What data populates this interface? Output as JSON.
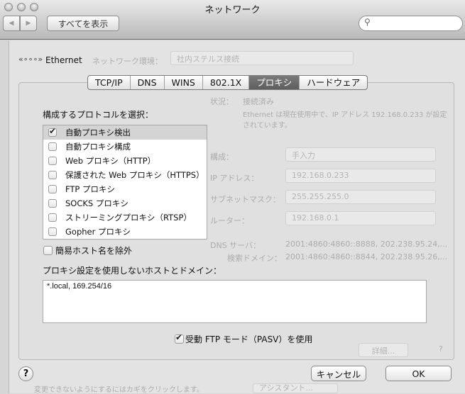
{
  "window": {
    "title": "ネットワーク"
  },
  "toolbar": {
    "back": "◀",
    "forward": "▶",
    "show_all": "すべてを表示",
    "search_placeholder": ""
  },
  "background": {
    "service": "Ethernet",
    "location_label": "ネットワーク環境：",
    "location_value": "社内ステルス接続",
    "status_label": "状況：",
    "status_value": "接続済み",
    "status_desc": "Ethernet は現在使用中で、IP アドレス 192.168.0.233 が設定されています。",
    "fields": [
      {
        "label": "構成：",
        "value": "手入力"
      },
      {
        "label": "IP アドレス：",
        "value": "192.168.0.233"
      },
      {
        "label": "サブネットマスク：",
        "value": "255.255.255.0"
      },
      {
        "label": "ルーター：",
        "value": "192.168.0.1"
      },
      {
        "label": "DNS サーバ：",
        "value": "2001:4860:4860::8888, 202.238.95.24,..."
      },
      {
        "label": "検索ドメイン：",
        "value": "2001:4860:4860::8844, 202.238.95.26,..."
      }
    ],
    "advanced": "詳細...",
    "lock_text": "変更できないようにするにはカギをクリックします。",
    "assistant": "アシスタント..."
  },
  "tabs": [
    "TCP/IP",
    "DNS",
    "WINS",
    "802.1X",
    "プロキシ",
    "ハードウェア"
  ],
  "proxy": {
    "select_label": "構成するプロトコルを選択：",
    "protocols": [
      {
        "label": "自動プロキシ検出",
        "checked": true
      },
      {
        "label": "自動プロキシ構成",
        "checked": false
      },
      {
        "label": "Web プロキシ（HTTP）",
        "checked": false
      },
      {
        "label": "保護された Web プロキシ（HTTPS）",
        "checked": false
      },
      {
        "label": "FTP プロキシ",
        "checked": false
      },
      {
        "label": "SOCKS プロキシ",
        "checked": false
      },
      {
        "label": "ストリーミングプロキシ（RTSP）",
        "checked": false
      },
      {
        "label": "Gopher プロキシ",
        "checked": false
      }
    ],
    "exclude_simple": "簡易ホスト名を除外",
    "bypass_label": "プロキシ設定を使用しないホストとドメイン：",
    "bypass_value": "*.local, 169.254/16",
    "pasv": "受動 FTP モード（PASV）を使用"
  },
  "buttons": {
    "help": "?",
    "cancel": "キャンセル",
    "ok": "OK"
  }
}
